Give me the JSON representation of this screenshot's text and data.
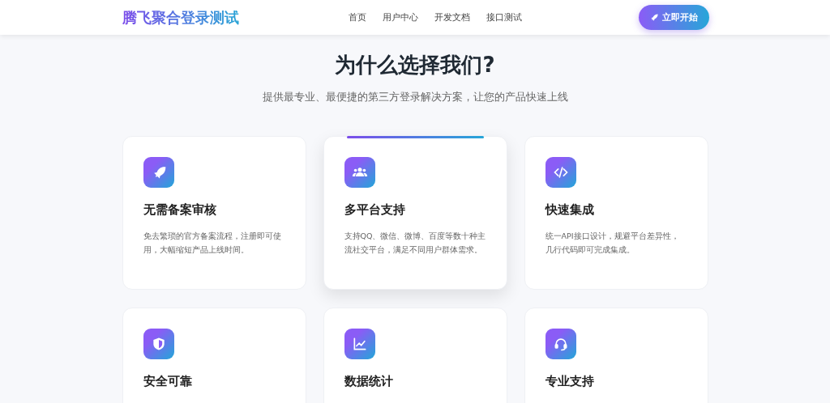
{
  "header": {
    "brand": "腾飞聚合登录测试",
    "nav": [
      {
        "label": "首页"
      },
      {
        "label": "用户中心"
      },
      {
        "label": "开发文档"
      },
      {
        "label": "接口测试"
      }
    ],
    "cta": "立即开始"
  },
  "section": {
    "title": "为什么选择我们?",
    "subtitle": "提供最专业、最便捷的第三方登录解决方案，让您的产品快速上线"
  },
  "features": [
    {
      "kind": "rocket",
      "title": "无需备案审核",
      "description": "免去繁琐的官方备案流程，注册即可使用，大幅缩短产品上线时间。",
      "hovered": false
    },
    {
      "kind": "users",
      "title": "多平台支持",
      "description": "支持QQ、微信、微博、百度等数十种主流社交平台，满足不同用户群体需求。",
      "hovered": true
    },
    {
      "kind": "code",
      "title": "快速集成",
      "description": "统一API接口设计，规避平台差异性，几行代码即可完成集成。",
      "hovered": false
    },
    {
      "kind": "shield",
      "title": "安全可靠",
      "hovered": false
    },
    {
      "kind": "chart",
      "title": "数据统计",
      "hovered": false
    },
    {
      "kind": "headset",
      "title": "专业支持",
      "hovered": false
    }
  ]
}
